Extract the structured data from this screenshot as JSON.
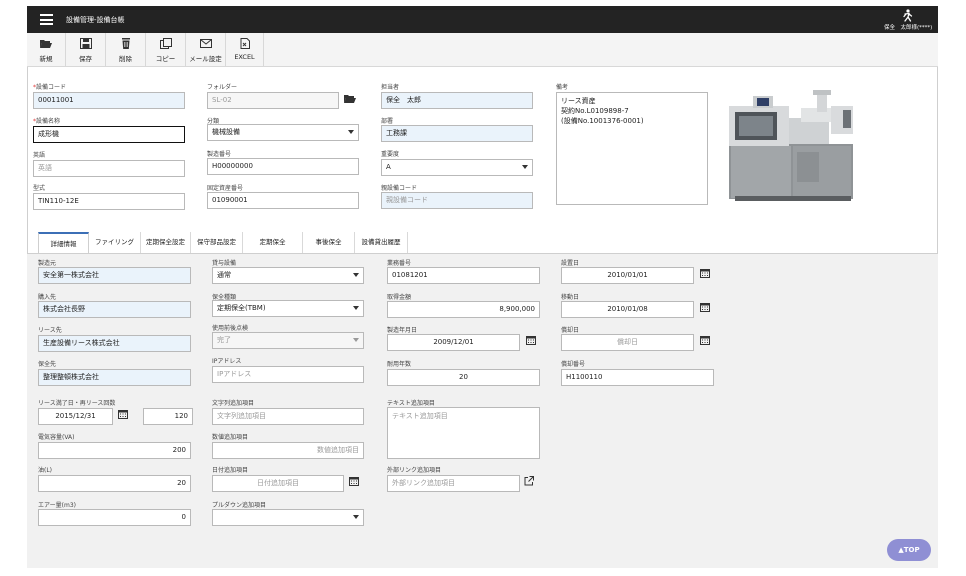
{
  "header": {
    "title": "設備管理-設備台帳",
    "user": "保全　太郎様(****)"
  },
  "toolbar": [
    {
      "label": "新規",
      "icon": "folder-open-icon"
    },
    {
      "label": "保存",
      "icon": "save-icon"
    },
    {
      "label": "削除",
      "icon": "trash-icon"
    },
    {
      "label": "コピー",
      "icon": "copy-icon"
    },
    {
      "label": "メール設定",
      "icon": "mail-icon"
    },
    {
      "label": "EXCEL",
      "icon": "excel-icon"
    }
  ],
  "form": {
    "equipment_code_label": "設備コード",
    "equipment_code": "00011001",
    "equipment_name_label": "設備名称",
    "equipment_name": "成形機",
    "english_label": "英語",
    "english_placeholder": "英語",
    "model_label": "型式",
    "model": "TIN110-12E",
    "folder_label": "フォルダー",
    "folder": "SL-02",
    "category_label": "分類",
    "category": "機械設備",
    "serial_label": "製造番号",
    "serial": "H00000000",
    "asset_label": "固定資産番号",
    "asset": "01090001",
    "person_label": "担当者",
    "person": "保全　太郎",
    "dept_label": "部署",
    "dept": "工務課",
    "importance_label": "重要度",
    "importance": "A",
    "parent_label": "親設備コード",
    "parent_placeholder": "親設備コード",
    "remarks_label": "備考",
    "remarks": "リース資産\n契約No.L0109898-7\n(設備No.1001376-0001)"
  },
  "tabs": [
    "詳細情報",
    "ファイリング",
    "定期保全設定",
    "保守部品設定",
    "定期保全",
    "事後保全",
    "設備貸出履歴"
  ],
  "detail": {
    "maker_label": "製造元",
    "maker": "安全第一株式会社",
    "vendor_label": "購入先",
    "vendor": "株式会社長野",
    "lessor_label": "リース先",
    "lessor": "生産設備リース株式会社",
    "maintainer_label": "保全先",
    "maintainer": "整理整頓株式会社",
    "lease_end_label": "リース満了日・再リース回数",
    "lease_end": "2015/12/31",
    "lease_count": "120",
    "power_label": "電気容量(VA)",
    "power": "200",
    "oil_label": "油(L)",
    "oil": "20",
    "air_label": "エアー量(m3)",
    "air": "0",
    "rental_label": "貸与設備",
    "rental": "通常",
    "mtype_label": "保全種類",
    "mtype": "定期保全(TBM)",
    "usage_label": "使用前後点検",
    "usage": "完了",
    "ip_label": "IPアドレス",
    "ip_placeholder": "IPアドレス",
    "text_extra_label": "文字列追加項目",
    "text_extra_placeholder": "文字列追加項目",
    "num_extra_label": "数値追加項目",
    "num_extra_placeholder": "数値追加項目",
    "date_extra_label": "日付追加項目",
    "date_extra_placeholder": "日付追加項目",
    "pulldown_label": "プルダウン追加項目",
    "contract_label": "業務番号",
    "contract": "01081201",
    "price_label": "取得金額",
    "price": "8,900,000",
    "mfg_date_label": "製造年月日",
    "mfg_date": "2009/12/01",
    "life_label": "耐用年数",
    "life": "20",
    "ttext_label": "テキスト追加項目",
    "ttext_placeholder": "テキスト追加項目",
    "link_label": "外部リンク追加項目",
    "link_placeholder": "外部リンク追加項目",
    "install_label": "設置日",
    "install": "2010/01/01",
    "move_label": "移動日",
    "move": "2010/01/08",
    "dispose_label": "償却日",
    "dispose_placeholder": "償却日",
    "dispose_no_label": "償却番号",
    "dispose_no": "H1100110"
  },
  "top_button": "▲TOP",
  "colors": {
    "header": "#232323",
    "tab_accent": "#3c6fb6",
    "top_button": "#8f8fd4",
    "required": "#e03030"
  }
}
